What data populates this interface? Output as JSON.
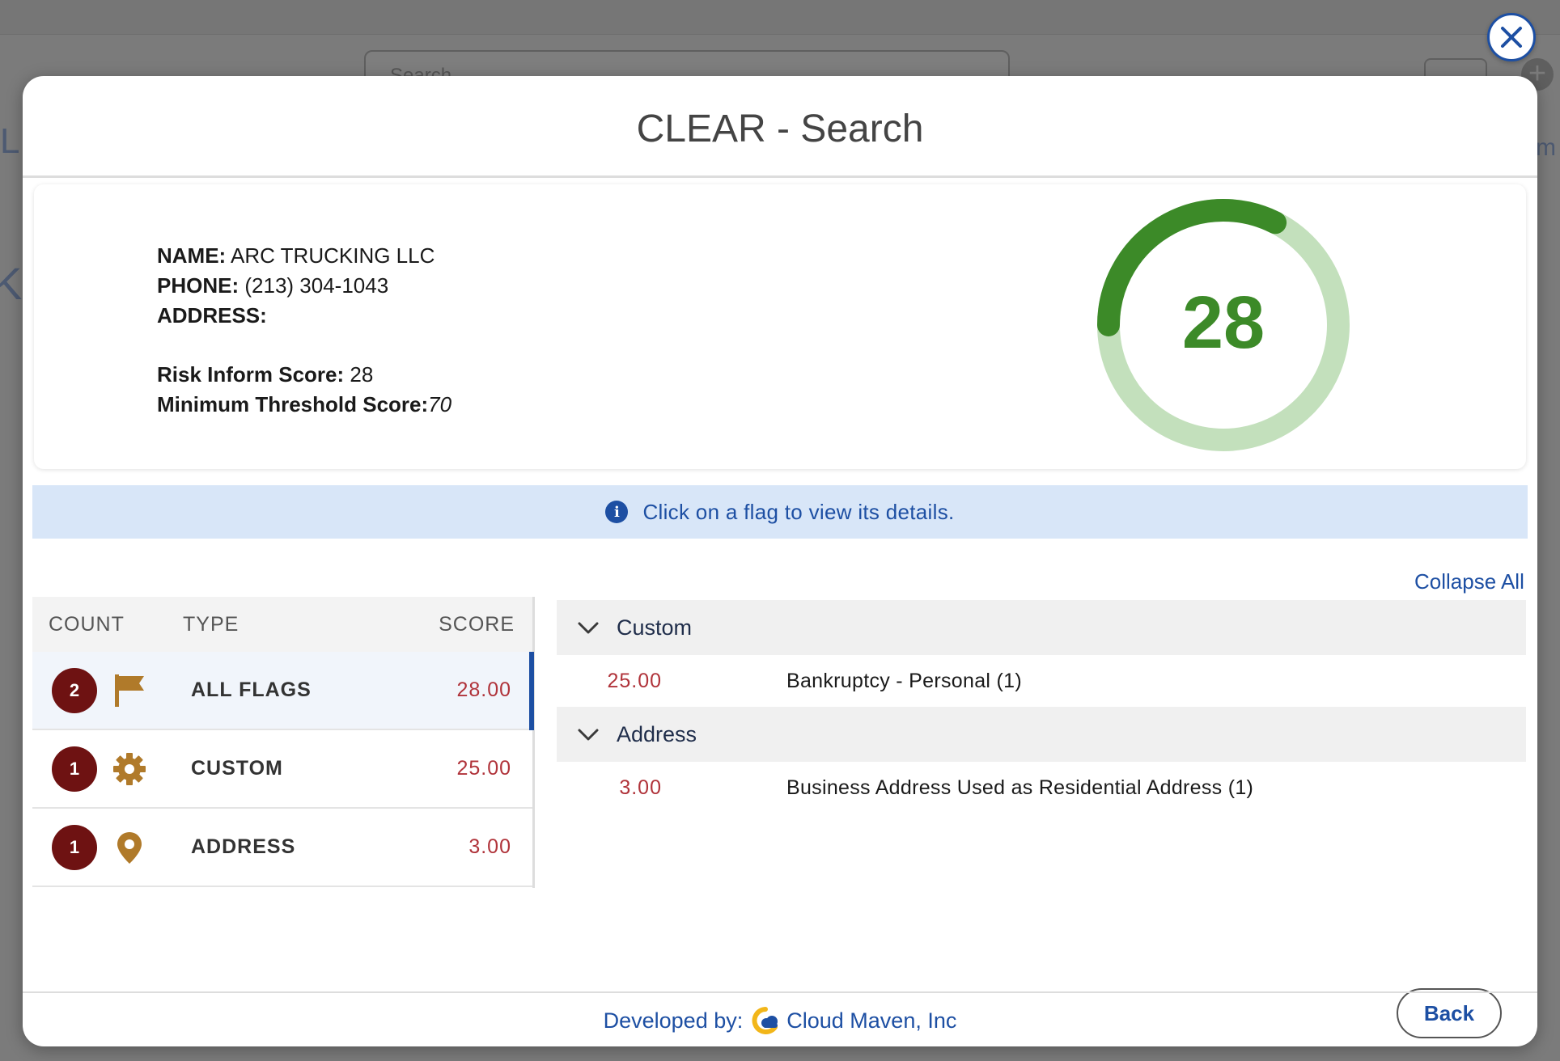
{
  "background": {
    "search_placeholder": "Search"
  },
  "modal": {
    "title": "CLEAR - Search"
  },
  "close_button": {
    "icon": "close-icon"
  },
  "info": {
    "name_label": "NAME:",
    "name_value": "ARC TRUCKING LLC",
    "phone_label": "PHONE:",
    "phone_value": "(213) 304-1043",
    "address_label": "ADDRESS:",
    "address_value": "",
    "risk_label": "Risk Inform Score:",
    "risk_value": "28",
    "threshold_label": "Minimum Threshold Score:",
    "threshold_value": "70"
  },
  "gauge": {
    "value": "28",
    "fraction": 0.28,
    "color_fill": "#3c8a28",
    "color_track": "#c3e0bc"
  },
  "banner": {
    "icon": "info-icon",
    "text": "Click on a flag to view its details."
  },
  "collapse_all": "Collapse All",
  "flags_table": {
    "headers": {
      "count": "COUNT",
      "type": "TYPE",
      "score": "SCORE"
    },
    "rows": [
      {
        "count": "2",
        "icon": "flag-icon",
        "type": "ALL FLAGS",
        "score": "28.00",
        "selected": true
      },
      {
        "count": "1",
        "icon": "gear-icon",
        "type": "CUSTOM",
        "score": "25.00",
        "selected": false
      },
      {
        "count": "1",
        "icon": "location-pin-icon",
        "type": "ADDRESS",
        "score": "3.00",
        "selected": false
      }
    ]
  },
  "details": {
    "groups": [
      {
        "title": "Custom",
        "items": [
          {
            "score": "25.00",
            "description": "Bankruptcy - Personal (1)"
          }
        ]
      },
      {
        "title": "Address",
        "items": [
          {
            "score": "3.00",
            "description": "Business Address Used as Residential Address (1)"
          }
        ]
      }
    ]
  },
  "back_button": "Back",
  "footer": {
    "prefix": "Developed by:",
    "company": "Cloud Maven, Inc"
  },
  "colors": {
    "accent": "#1d4fa3",
    "score_red": "#b0333a",
    "badge": "#6e1212",
    "icon_gold": "#b07a2a"
  }
}
